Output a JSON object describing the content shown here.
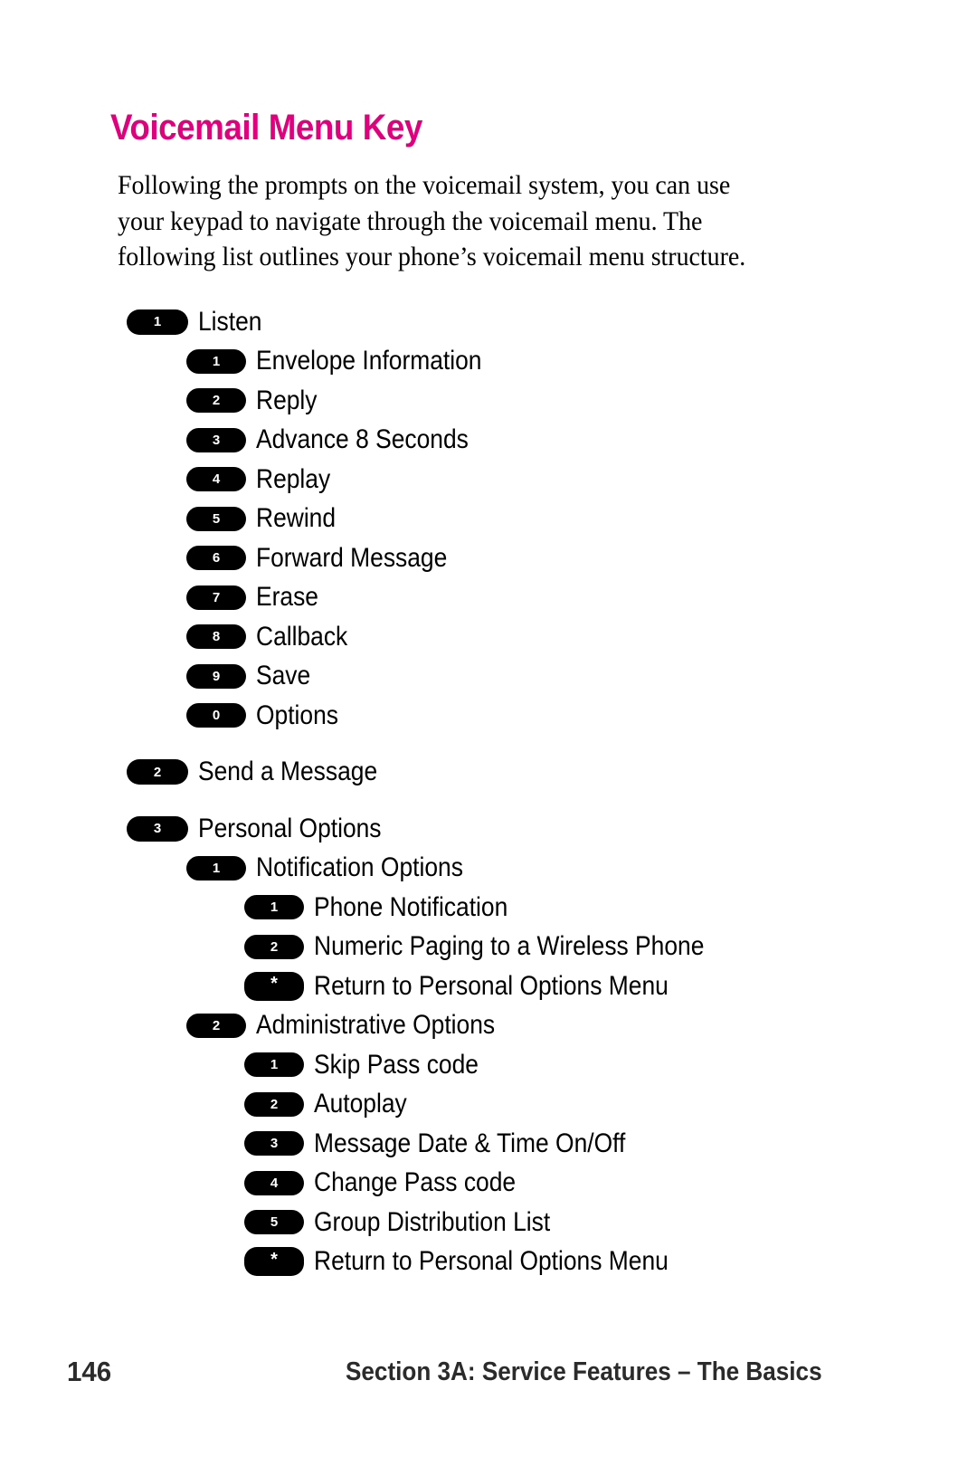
{
  "document": {
    "title": "Voicemail Menu Key",
    "title_color": "#e0007d",
    "intro": "Following the prompts on the voicemail system, you can use your keypad to navigate through the voicemail menu. The following list outlines your phone’s voicemail menu structure."
  },
  "menu": {
    "rows": [
      {
        "key": "1",
        "label": "Listen",
        "level": 1,
        "gap_before": false
      },
      {
        "key": "1",
        "label": "Envelope Information",
        "level": 2,
        "gap_before": false
      },
      {
        "key": "2",
        "label": "Reply",
        "level": 2,
        "gap_before": false
      },
      {
        "key": "3",
        "label": "Advance 8 Seconds",
        "level": 2,
        "gap_before": false
      },
      {
        "key": "4",
        "label": "Replay",
        "level": 2,
        "gap_before": false
      },
      {
        "key": "5",
        "label": "Rewind",
        "level": 2,
        "gap_before": false
      },
      {
        "key": "6",
        "label": "Forward Message",
        "level": 2,
        "gap_before": false
      },
      {
        "key": "7",
        "label": "Erase",
        "level": 2,
        "gap_before": false
      },
      {
        "key": "8",
        "label": "Callback",
        "level": 2,
        "gap_before": false
      },
      {
        "key": "9",
        "label": "Save",
        "level": 2,
        "gap_before": false
      },
      {
        "key": "0",
        "label": "Options",
        "level": 2,
        "gap_before": false
      },
      {
        "key": "2",
        "label": "Send a Message",
        "level": 1,
        "gap_before": true
      },
      {
        "key": "3",
        "label": "Personal Options",
        "level": 1,
        "gap_before": true
      },
      {
        "key": "1",
        "label": "Notification Options",
        "level": 2,
        "gap_before": false
      },
      {
        "key": "1",
        "label": "Phone Notification",
        "level": 3,
        "gap_before": false
      },
      {
        "key": "2",
        "label": "Numeric Paging to a Wireless Phone",
        "level": 3,
        "gap_before": false
      },
      {
        "key": "*",
        "label": "Return to Personal Options Menu",
        "level": 3,
        "gap_before": false
      },
      {
        "key": "2",
        "label": "Administrative Options",
        "level": 2,
        "gap_before": false
      },
      {
        "key": "1",
        "label": "Skip Pass code",
        "level": 3,
        "gap_before": false
      },
      {
        "key": "2",
        "label": "Autoplay",
        "level": 3,
        "gap_before": false
      },
      {
        "key": "3",
        "label": "Message Date & Time On/Off",
        "level": 3,
        "gap_before": false
      },
      {
        "key": "4",
        "label": "Change Pass code",
        "level": 3,
        "gap_before": false
      },
      {
        "key": "5",
        "label": "Group Distribution List",
        "level": 3,
        "gap_before": false
      },
      {
        "key": "*",
        "label": "Return to Personal Options Menu",
        "level": 3,
        "gap_before": false
      }
    ]
  },
  "footer": {
    "page_number": "146",
    "section": "Section 3A: Service Features – The Basics"
  }
}
